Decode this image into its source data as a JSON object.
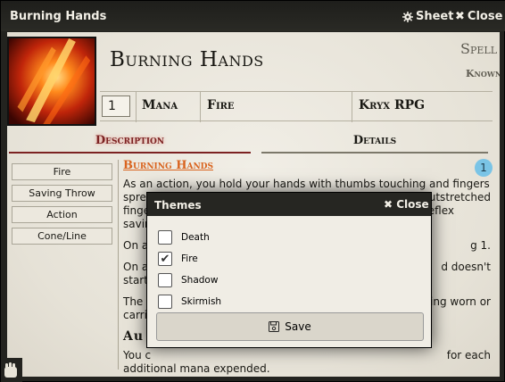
{
  "window": {
    "title": "Burning Hands",
    "sheet_label": "Sheet",
    "close_label": "Close"
  },
  "header": {
    "name": "Burning Hands",
    "type": "Spell",
    "status": "Known",
    "mana_value": "1",
    "mana_label": "Mana",
    "element": "Fire",
    "system": "Kryx RPG"
  },
  "tabs": {
    "description": "Description",
    "details": "Details"
  },
  "tags": [
    "Fire",
    "Saving Throw",
    "Action",
    "Cone/Line"
  ],
  "description": {
    "heading": "Burning Hands",
    "badge": "1",
    "paragraphs": [
      "As an action, you hold your hands with thumbs touching and fingers spread as a thin sheet of flames shoots forth from your outstretched fingertips. Each creature in a cone or line must make a Reflex saving throw.",
      "On a",
      "On a",
      "The f",
      "Au",
      "You c",
      "additional mana expended."
    ],
    "para2_tail": "g 1.",
    "para3_tail": "d doesn't",
    "para3_line2": "start",
    "para4_tail": "ing worn or",
    "para4_line2": "carri",
    "para6_tail": "for each"
  },
  "dialog": {
    "title": "Themes",
    "close_label": "Close",
    "options": [
      {
        "label": "Death",
        "checked": false
      },
      {
        "label": "Fire",
        "checked": true
      },
      {
        "label": "Shadow",
        "checked": false
      },
      {
        "label": "Skirmish",
        "checked": false
      }
    ],
    "save_label": "Save"
  },
  "colors": {
    "accent_tab": "#7c2222",
    "heading_orange": "#d9641f",
    "badge_blue": "#7ac4e6"
  }
}
